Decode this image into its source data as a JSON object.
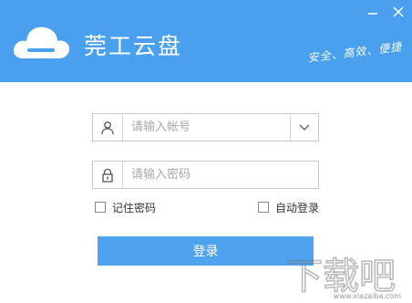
{
  "header": {
    "brand": "莞工云盘",
    "slogan": "安全、高效、便捷",
    "accent_color": "#4aa0ef"
  },
  "window_controls": {
    "minimize_icon": "minimize-icon",
    "close_icon": "close-icon"
  },
  "login": {
    "account_placeholder": "请输入帐号",
    "account_value": "",
    "password_placeholder": "请输入密码",
    "password_value": "",
    "remember_password_label": "记住密码",
    "auto_login_label": "自动登录",
    "submit_label": "登录"
  },
  "watermark": {
    "text": "下载吧",
    "sub": "www.xiazaiba.com"
  }
}
